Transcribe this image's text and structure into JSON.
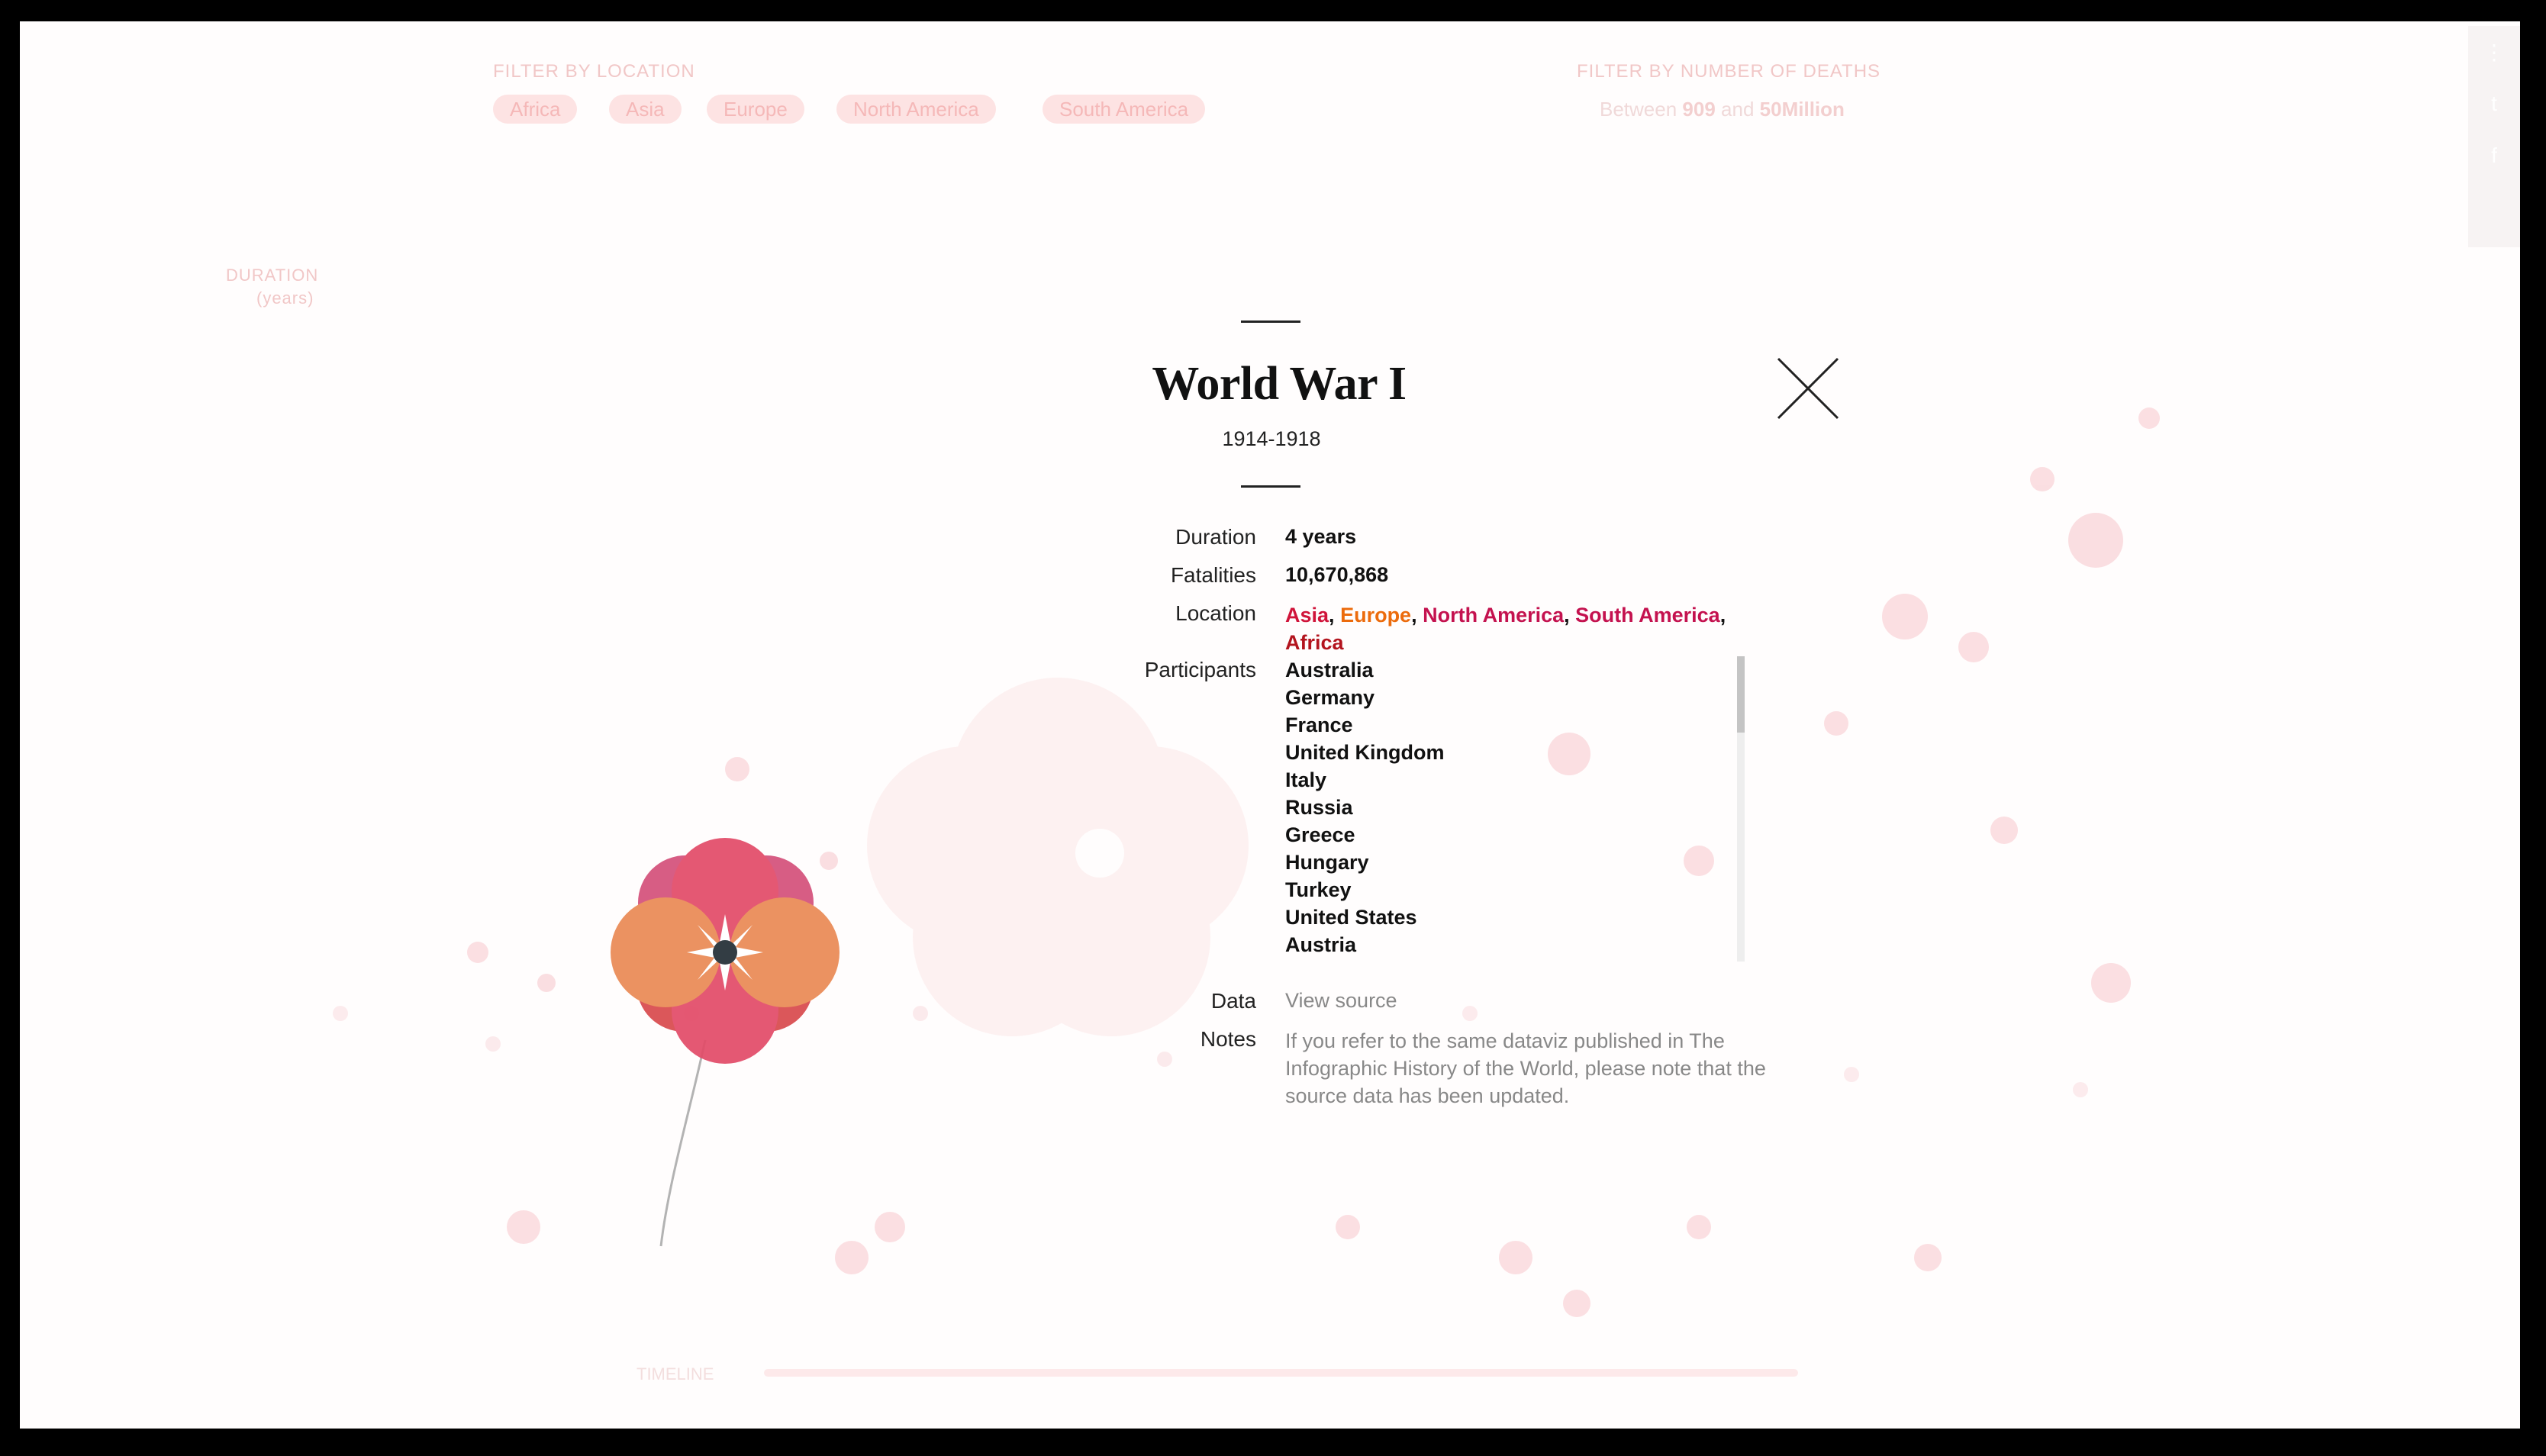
{
  "background": {
    "filter_location_label": "FILTER BY LOCATION",
    "location_chips": [
      "Africa",
      "Asia",
      "Europe",
      "North America",
      "South America"
    ],
    "filter_deaths_label": "FILTER BY NUMBER OF DEATHS",
    "deaths_range": {
      "prefix": "Between",
      "min": "909",
      "mid": "and",
      "max": "50Million"
    },
    "duration_label": "DURATION",
    "duration_unit": "(years)",
    "timeline_label": "TIMELINE"
  },
  "modal": {
    "title": "World War I",
    "dates": "1914-1918",
    "duration_label": "Duration",
    "duration_value": "4 years",
    "fatalities_label": "Fatalities",
    "fatalities_value": "10,670,868",
    "location_label": "Location",
    "locations": [
      {
        "name": "Asia",
        "color": "#d0143a"
      },
      {
        "name": "Europe",
        "color": "#ec6b0c"
      },
      {
        "name": "North America",
        "color": "#c4124f"
      },
      {
        "name": "South America",
        "color": "#c4124f"
      },
      {
        "name": "Africa",
        "color": "#b3141e"
      }
    ],
    "participants_label": "Participants",
    "participants": [
      "Australia",
      "Germany",
      "France",
      "United Kingdom",
      "Italy",
      "Russia",
      "Greece",
      "Hungary",
      "Turkey",
      "United States",
      "Austria"
    ],
    "data_label": "Data",
    "source_link": "View source",
    "notes_label": "Notes",
    "notes_text": "If you refer to the same dataviz published in The Infographic History of the World, please note that the source data has been updated."
  },
  "icons": {
    "close": "close-icon",
    "share": "share-icon",
    "twitter": "twitter-icon",
    "facebook": "facebook-icon"
  },
  "colors": {
    "flower_pink": "#e24b68",
    "flower_orange": "#ea8a54",
    "flower_magenta": "#d4507a",
    "flower_red": "#d8494d",
    "center": "#333d44"
  }
}
